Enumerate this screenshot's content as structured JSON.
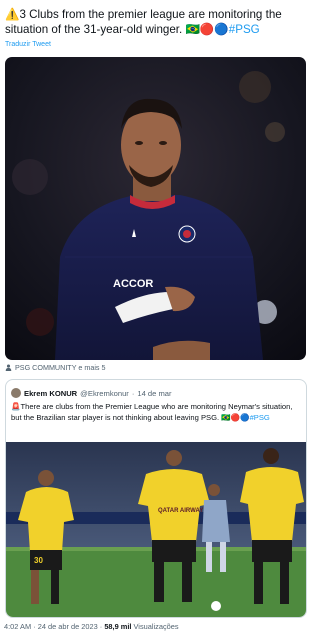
{
  "tweet": {
    "warning_emoji": "⚠️",
    "text": "3 Clubs from the premier league are monitoring the situation of the 31-year-old winger. 🇧🇷🔴🔵",
    "hashtag": "#PSG",
    "translate_label": "Traduzir Tweet",
    "tagged_label": "PSG COMMUNITY e mais 5"
  },
  "main_photo": {
    "kit_letters": "ACCOR",
    "crest_label": "PSG"
  },
  "quote": {
    "name": "Ekrem KONUR",
    "handle": "@Ekremkonur",
    "date": "14 de mar",
    "alert_emoji": "🚨",
    "text": "There are clubs from the Premier League who are monitoring Neymar's situation, but the Brazilian star player is not thinking about leaving PSG. 🇧🇷🔴🔵",
    "hashtag": "#PSG"
  },
  "quote_photo": {
    "sponsor": "QATAR AIRWAYS",
    "shirt_number": "30"
  },
  "footer": {
    "time": "4:02 AM",
    "dot1": "·",
    "date": "24 de abr de 2023",
    "dot2": "·",
    "views": "58,9 mil",
    "views_label": "Visualizações"
  },
  "colors": {
    "accent": "#1d9bf0",
    "psg_navy": "#1a1f4e",
    "training_yellow": "#f1d12b"
  }
}
